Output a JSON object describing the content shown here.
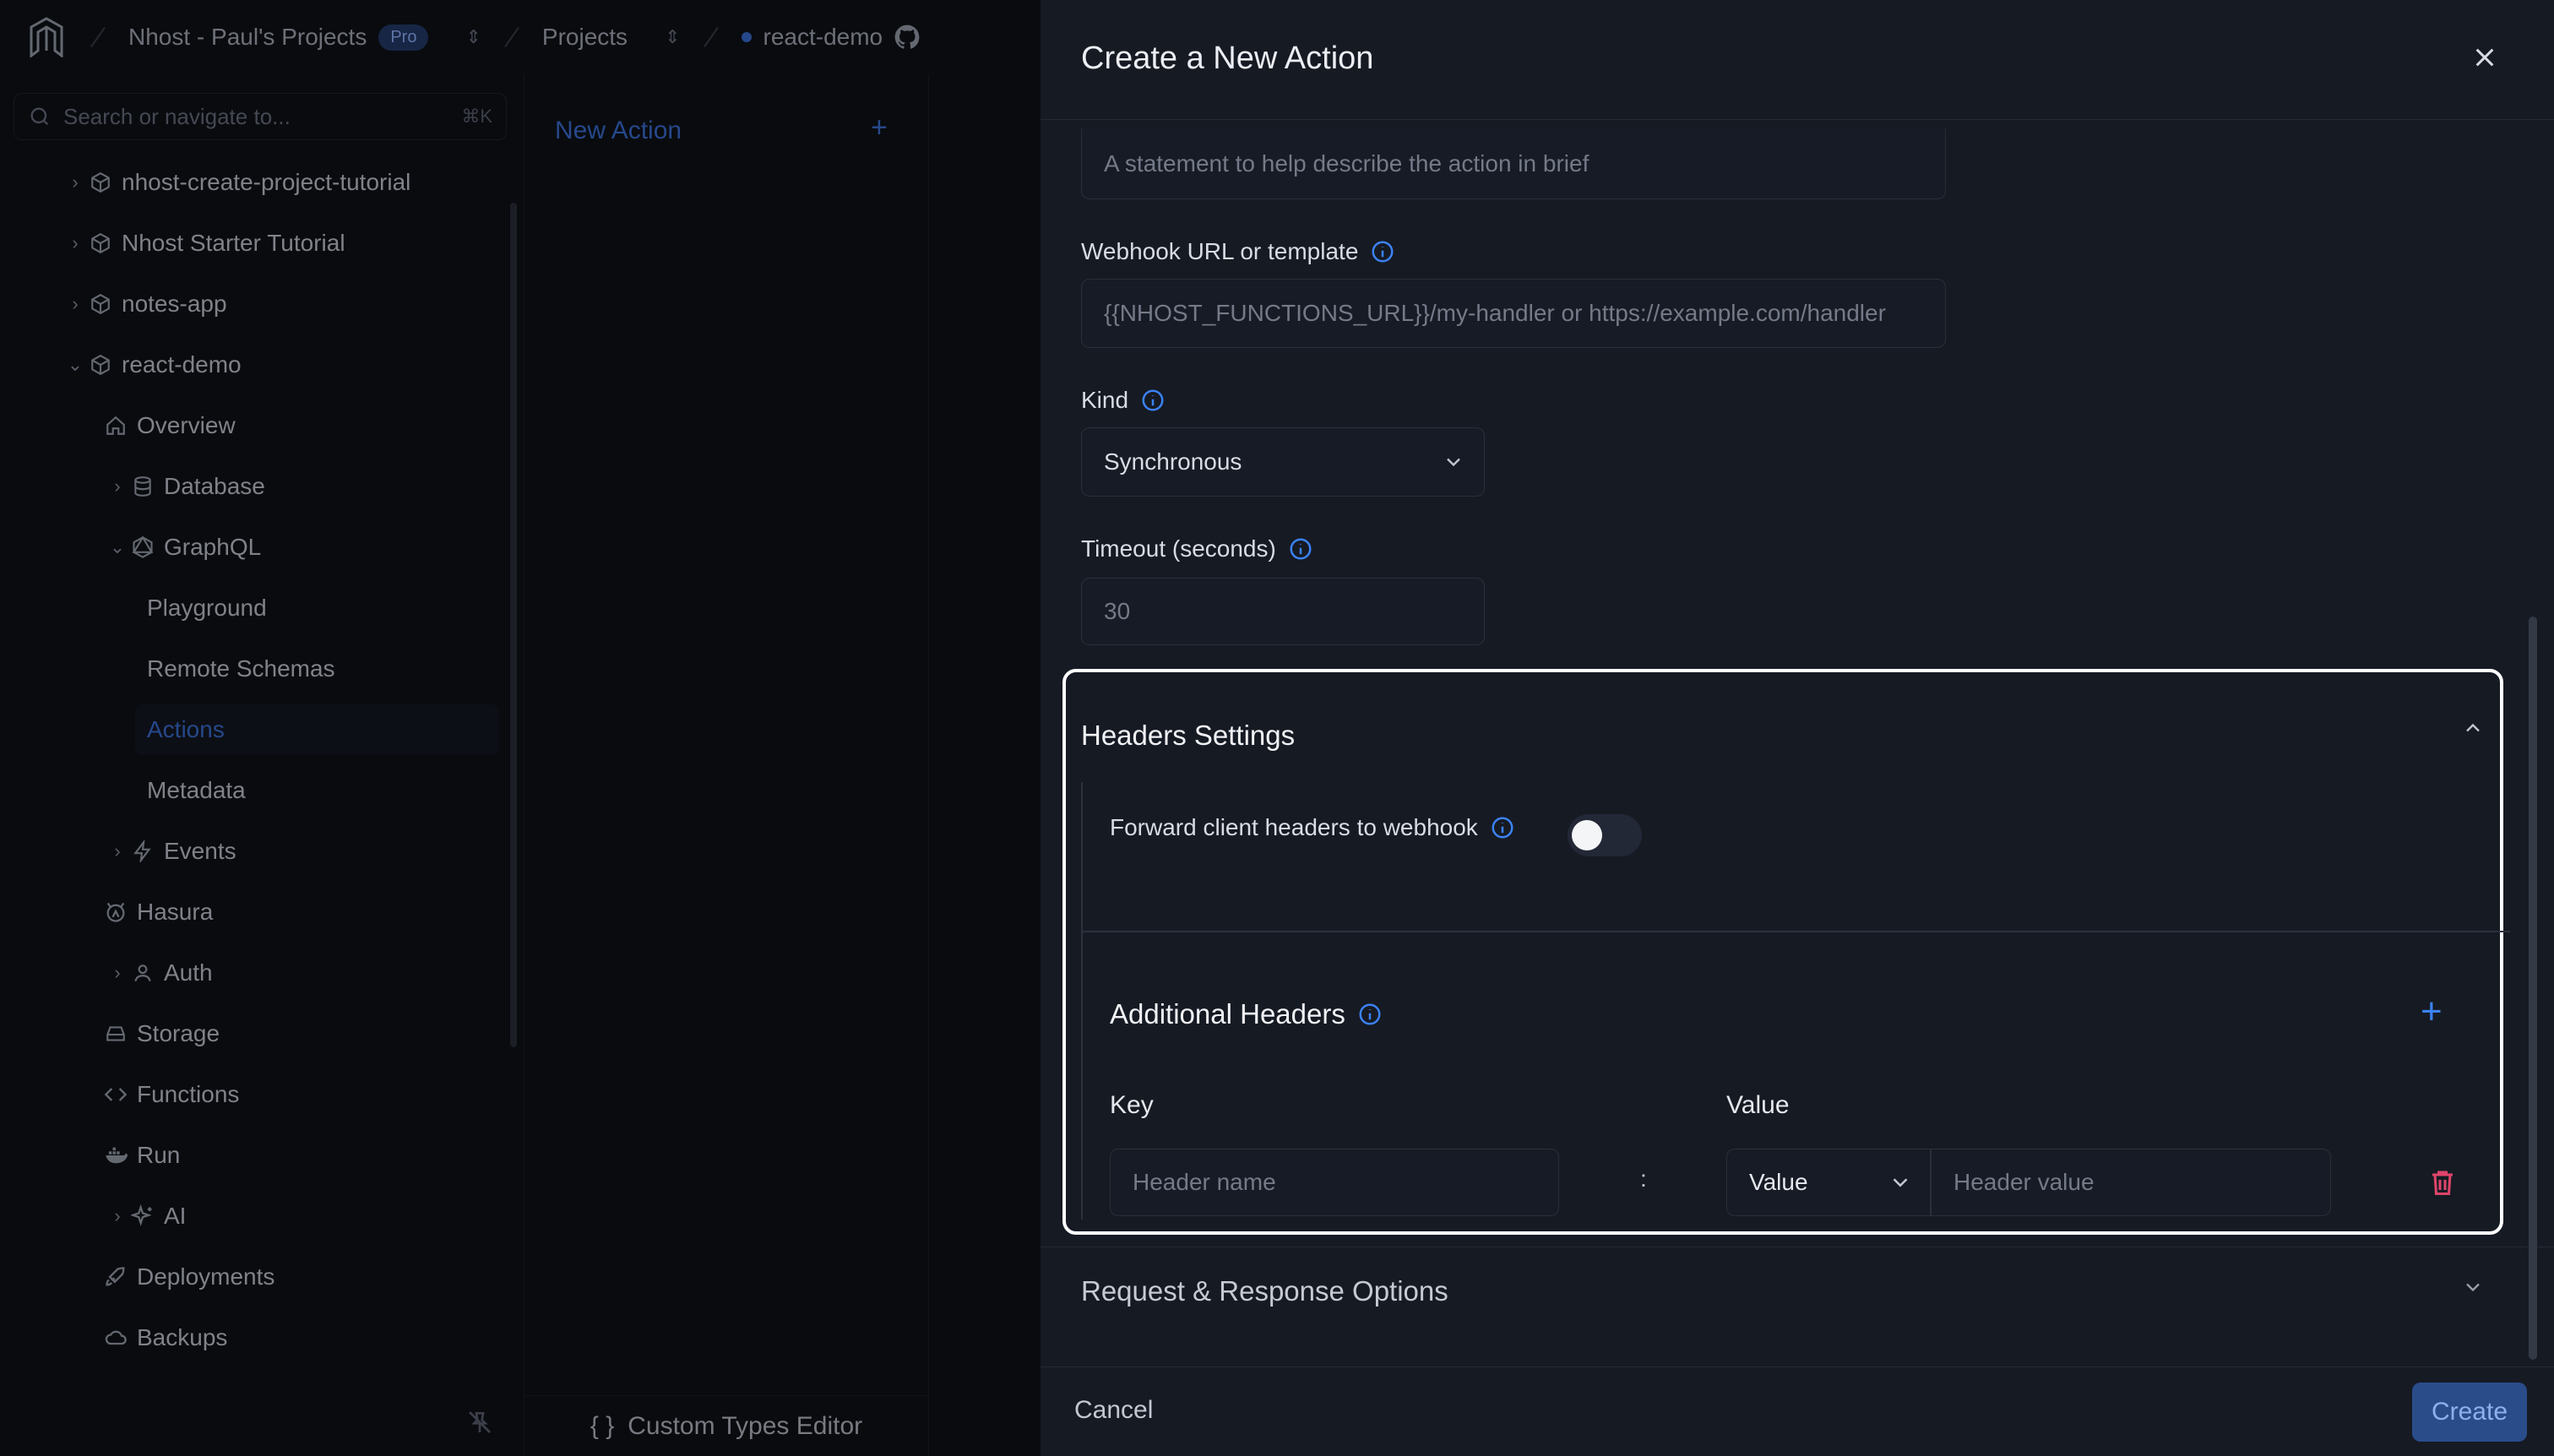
{
  "topbar": {
    "org": "Nhost - Paul's Projects",
    "plan_badge": "Pro",
    "projects": "Projects",
    "project": "react-demo"
  },
  "search": {
    "placeholder": "Search or navigate to...",
    "shortcut": "⌘K"
  },
  "sidebar": {
    "items": [
      {
        "label": "nhost-create-project-tutorial"
      },
      {
        "label": "Nhost Starter Tutorial"
      },
      {
        "label": "notes-app"
      },
      {
        "label": "react-demo"
      },
      {
        "label": "Overview"
      },
      {
        "label": "Database"
      },
      {
        "label": "GraphQL"
      },
      {
        "label": "Playground"
      },
      {
        "label": "Remote Schemas"
      },
      {
        "label": "Actions"
      },
      {
        "label": "Metadata"
      },
      {
        "label": "Events"
      },
      {
        "label": "Hasura"
      },
      {
        "label": "Auth"
      },
      {
        "label": "Storage"
      },
      {
        "label": "Functions"
      },
      {
        "label": "Run"
      },
      {
        "label": "AI"
      },
      {
        "label": "Deployments"
      },
      {
        "label": "Backups"
      }
    ]
  },
  "actions_panel": {
    "new_action": "New Action",
    "custom_types": "Custom Types Editor"
  },
  "drawer": {
    "title": "Create a New Action",
    "description_placeholder": "A statement to help describe the action in brief",
    "webhook_label": "Webhook URL or template",
    "webhook_placeholder": "{{NHOST_FUNCTIONS_URL}}/my-handler or https://example.com/handler",
    "kind_label": "Kind",
    "kind_value": "Synchronous",
    "timeout_label": "Timeout (seconds)",
    "timeout_value": "30",
    "headers_settings": {
      "title": "Headers Settings",
      "forward_label": "Forward client headers to webhook",
      "forward_enabled": false,
      "additional_title": "Additional Headers",
      "key_label": "Key",
      "value_label": "Value",
      "key_placeholder": "Header name",
      "separator": ":",
      "value_type": "Value",
      "value_placeholder": "Header value"
    },
    "request_response_title": "Request & Response Options",
    "cancel_label": "Cancel",
    "create_label": "Create"
  },
  "colors": {
    "accent": "#3b6fd6",
    "danger": "#e0456b",
    "drawer_bg": "#161a23"
  }
}
